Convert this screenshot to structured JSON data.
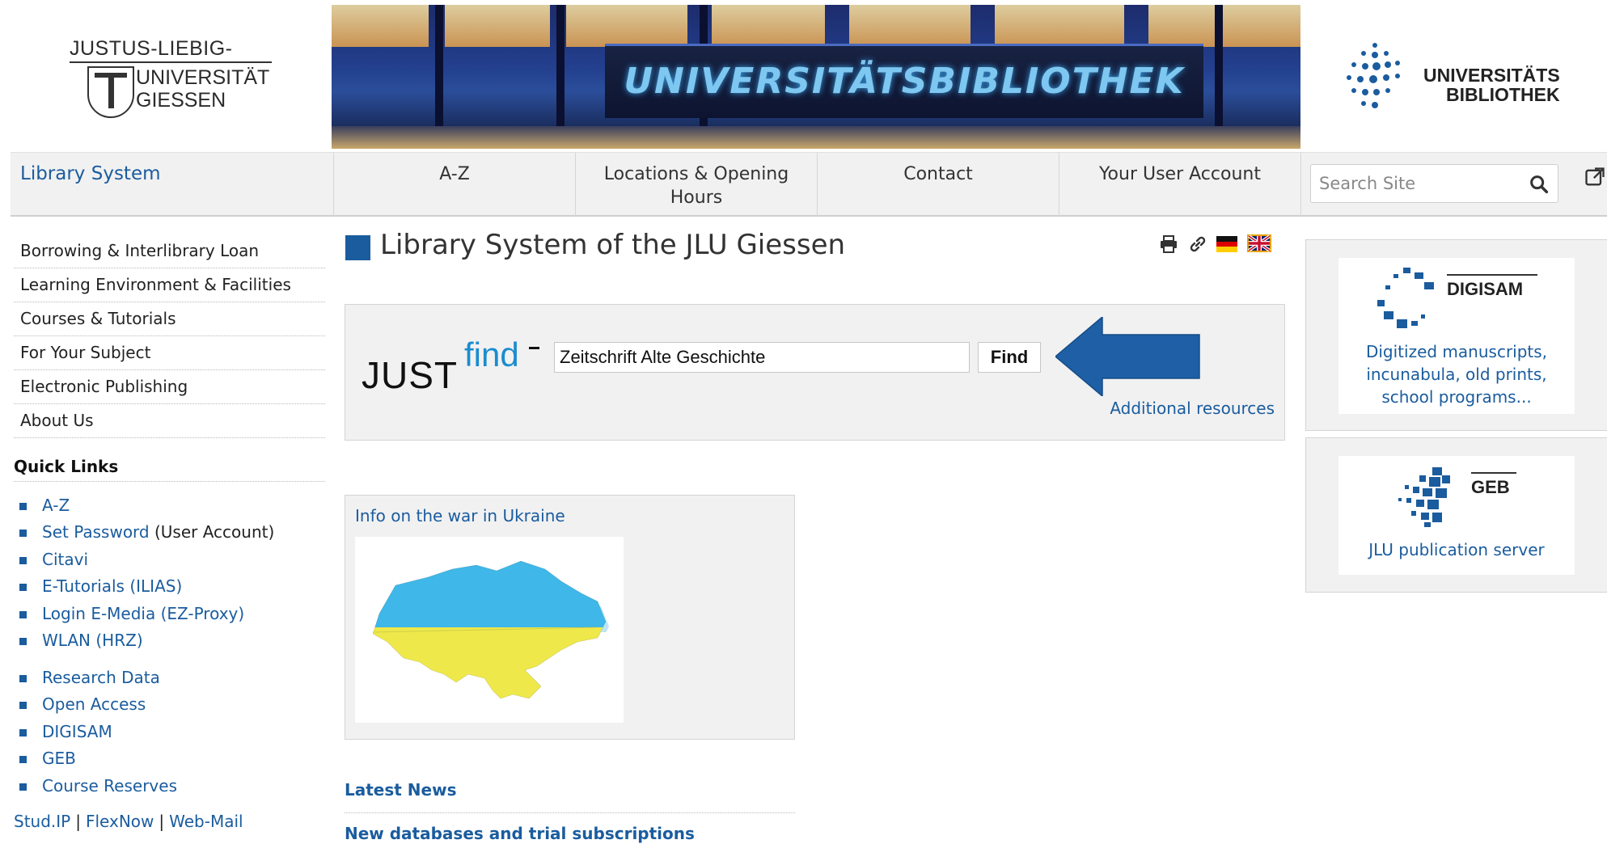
{
  "header": {
    "jlu_logo_lines": [
      "JUSTUS-LIEBIG-",
      "UNIVERSITÄT",
      "GIESSEN"
    ],
    "banner_text": "UNIVERSITÄTSBIBLIOTHEK",
    "ub_logo_lines": [
      "UNIVERSITÄTS",
      "BIBLIOTHEK"
    ]
  },
  "nav": {
    "home": "Library System",
    "az": "A-Z",
    "locations": "Locations & Opening Hours",
    "contact": "Contact",
    "account": "Your User Account",
    "search_placeholder": "Search Site"
  },
  "sidebar": {
    "items": [
      "Borrowing & Interlibrary Loan",
      "Learning Environment & Facilities",
      "Courses & Tutorials",
      "For Your Subject",
      "Electronic Publishing",
      "About Us"
    ],
    "quick_links_title": "Quick Links",
    "quick_links": [
      {
        "label": "A-Z",
        "suffix": ""
      },
      {
        "label": "Set Password",
        "suffix": "(User Account)"
      },
      {
        "label": "Citavi",
        "suffix": ""
      },
      {
        "label": "E-Tutorials (ILIAS)",
        "suffix": ""
      },
      {
        "label": "Login E-Media (EZ-Proxy)",
        "suffix": ""
      },
      {
        "label": "WLAN (HRZ)",
        "suffix": ""
      },
      {
        "label": "Research Data",
        "suffix": ""
      },
      {
        "label": "Open Access",
        "suffix": ""
      },
      {
        "label": "DIGISAM",
        "suffix": ""
      },
      {
        "label": "GEB",
        "suffix": ""
      },
      {
        "label": "Course Reserves",
        "suffix": ""
      }
    ],
    "bottom_links": [
      "Stud.IP",
      "FlexNow",
      "Web-Mail"
    ],
    "bottom_sep": "|"
  },
  "main": {
    "title": "Library System of the JLU Giessen",
    "justfind": {
      "logo_just": "JUST",
      "logo_find": "find",
      "query": "Zeitschrift Alte Geschichte",
      "button": "Find",
      "additional": "Additional resources"
    },
    "ukraine_title": "Info on the war in Ukraine",
    "latest_news": "Latest News",
    "new_databases": "New databases and trial subscriptions"
  },
  "right": {
    "digisam_label": "DIGISAM",
    "digisam_desc": [
      "Digitized manuscripts,",
      "incunabula, old prints,",
      "school programs..."
    ],
    "geb_label": "GEB",
    "geb_desc": "JLU publication server"
  },
  "colors": {
    "link": "#1a5c9e",
    "panel": "#f1f1f1",
    "arrow": "#1e5fa6",
    "ukraine_blue": "#3fb7e8",
    "ukraine_yellow": "#eee84a"
  }
}
